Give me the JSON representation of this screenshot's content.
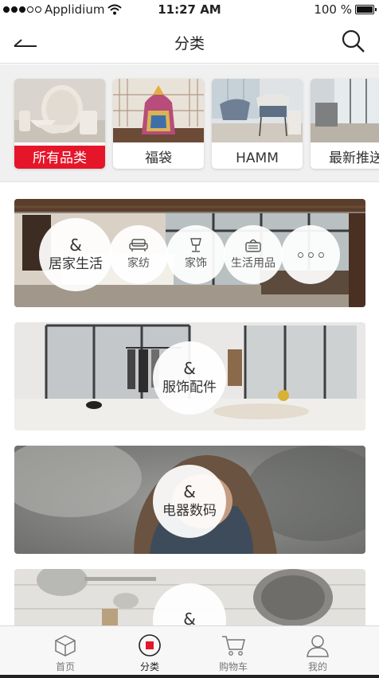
{
  "status_bar": {
    "carrier": "Applidium",
    "time": "11:27 AM",
    "battery": "100 %"
  },
  "nav": {
    "title": "分类",
    "back_icon": "back-arrow-icon",
    "search_icon": "search-icon"
  },
  "categories": [
    {
      "label": "所有品类",
      "active": true
    },
    {
      "label": "福袋",
      "active": false
    },
    {
      "label": "HAMM",
      "active": false
    },
    {
      "label": "最新推送",
      "active": false
    }
  ],
  "banners": [
    {
      "main": {
        "symbol": "&",
        "label": "居家生活"
      },
      "subs": [
        {
          "label": "家纺",
          "icon": "sofa-icon"
        },
        {
          "label": "家饰",
          "icon": "lamp-icon"
        },
        {
          "label": "生活用品",
          "icon": "basket-icon"
        },
        {
          "label": "",
          "icon": "more-dots-icon"
        }
      ]
    },
    {
      "main": {
        "symbol": "&",
        "label": "服饰配件"
      }
    },
    {
      "main": {
        "symbol": "&",
        "label": "电器数码"
      }
    },
    {
      "main": {
        "symbol": "&",
        "label": ""
      }
    }
  ],
  "tabs": [
    {
      "label": "首页",
      "icon": "box-icon",
      "active": false
    },
    {
      "label": "分类",
      "icon": "category-target-icon",
      "active": true
    },
    {
      "label": "购物车",
      "icon": "cart-icon",
      "active": false
    },
    {
      "label": "我的",
      "icon": "user-icon",
      "active": false
    }
  ],
  "colors": {
    "accent": "#e5162a"
  }
}
